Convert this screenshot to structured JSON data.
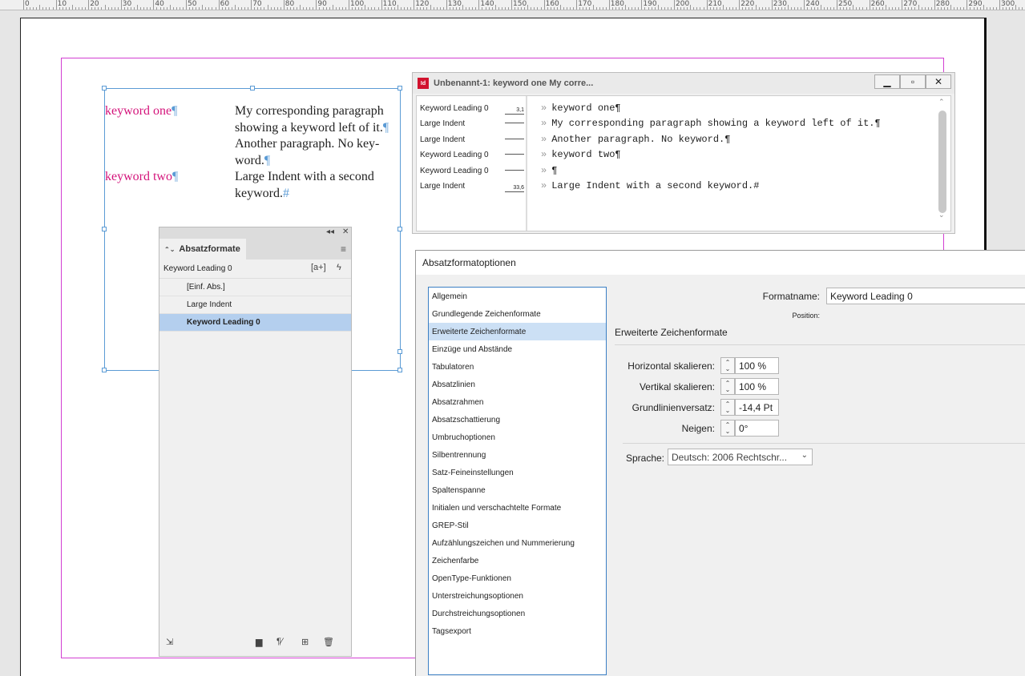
{
  "ruler": {
    "labels": [
      "0",
      "10",
      "20",
      "30",
      "40",
      "50",
      "60",
      "70",
      "80",
      "90",
      "100",
      "110",
      "120",
      "130",
      "140",
      "150",
      "160",
      "170",
      "180",
      "190",
      "200",
      "210",
      "220",
      "230",
      "240",
      "250",
      "260",
      "270",
      "280",
      "290",
      "300"
    ]
  },
  "document": {
    "text_frame": {
      "keyword_one": "keyword one",
      "para1": [
        "My corresponding paragraph",
        "showing a keyword left of it.",
        "Another paragraph. No key-",
        "word."
      ],
      "keyword_two": "keyword two",
      "para2": [
        "Large Indent with a second",
        "keyword."
      ],
      "pilcrow": "¶",
      "end_mark": "#"
    }
  },
  "story_editor": {
    "title": "Unbenannt-1: keyword one My corre...",
    "app_icon": "Id",
    "buttons": {
      "minimize": "▁",
      "maximize": "▫",
      "close": "✕"
    },
    "rows": [
      {
        "style": "Keyword Leading 0",
        "depth": "3,1",
        "text": "keyword one¶"
      },
      {
        "style": "Large Indent",
        "depth": "",
        "text": "My corresponding paragraph showing a keyword left of it.¶"
      },
      {
        "style": "Large Indent",
        "depth": "",
        "text": "Another paragraph. No keyword.¶"
      },
      {
        "style": "Keyword Leading 0",
        "depth": "",
        "text": "keyword two¶"
      },
      {
        "style": "Keyword Leading 0",
        "depth": "",
        "text": "¶"
      },
      {
        "style": "Large Indent",
        "depth": "33,6",
        "text": "Large Indent with a second keyword.#"
      }
    ],
    "arrow_glyph": "»"
  },
  "styles_panel": {
    "collapse": "◂◂",
    "close": "✕",
    "tab_label": "Absatzformate",
    "tab_arrows": "⌃⌄",
    "menu_icon": "≡",
    "current_style": "Keyword Leading 0",
    "create_override_icon": "[a+]",
    "lightning_icon": "ϟ",
    "items": [
      {
        "label": "[Einf. Abs.]",
        "selected": false
      },
      {
        "label": "Large Indent",
        "selected": false
      },
      {
        "label": "Keyword Leading 0",
        "selected": true
      }
    ],
    "footer": {
      "load": "⇲",
      "folder": "▆",
      "clear": "¶⁄",
      "new": "⊞",
      "delete": "🗑"
    }
  },
  "dialog": {
    "title": "Absatzformatoptionen",
    "categories": [
      "Allgemein",
      "Grundlegende Zeichenformate",
      "Erweiterte Zeichenformate",
      "Einzüge und Abstände",
      "Tabulatoren",
      "Absatzlinien",
      "Absatzrahmen",
      "Absatzschattierung",
      "Umbruchoptionen",
      "Silbentrennung",
      "Satz-Feineinstellungen",
      "Spaltenspanne",
      "Initialen und verschachtelte Formate",
      "GREP-Stil",
      "Aufzählungszeichen und Nummerierung",
      "Zeichenfarbe",
      "OpenType-Funktionen",
      "Unterstreichungsoptionen",
      "Durchstreichungsoptionen",
      "Tagsexport"
    ],
    "selected_category": 2,
    "format_name_label": "Formatname:",
    "format_name_value": "Keyword Leading 0",
    "position_label": "Position:",
    "section_title": "Erweiterte Zeichenformate",
    "fields": [
      {
        "label": "Horizontal skalieren:",
        "value": "100 %"
      },
      {
        "label": "Vertikal skalieren:",
        "value": "100 %"
      },
      {
        "label": "Grundlinienversatz:",
        "value": "-14,4 Pt"
      },
      {
        "label": "Neigen:",
        "value": "0°"
      }
    ],
    "language_label": "Sprache:",
    "language_value": "Deutsch: 2006 Rechtschr...",
    "spin_up": "⌃",
    "spin_down": "⌄",
    "dropdown_arrow": "⌄"
  }
}
